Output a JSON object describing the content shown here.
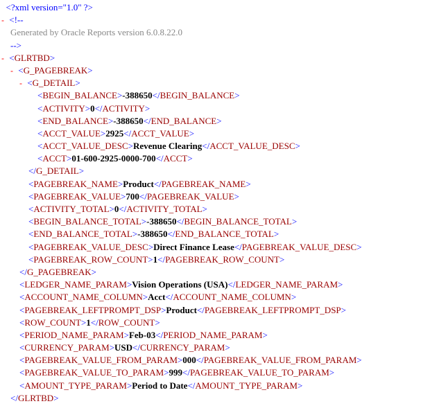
{
  "xml_decl": "<?xml version=\"1.0\" ?>",
  "comment": "Generated by Oracle Reports version 6.0.8.22.0",
  "toggles": {
    "minus": "-"
  },
  "tags": {
    "GLRTBD": "GLRTBD",
    "G_PAGEBREAK": "G_PAGEBREAK",
    "G_DETAIL": "G_DETAIL",
    "BEGIN_BALANCE": "BEGIN_BALANCE",
    "ACTIVITY": "ACTIVITY",
    "END_BALANCE": "END_BALANCE",
    "ACCT_VALUE": "ACCT_VALUE",
    "ACCT_VALUE_DESC": "ACCT_VALUE_DESC",
    "ACCT": "ACCT",
    "PAGEBREAK_NAME": "PAGEBREAK_NAME",
    "PAGEBREAK_VALUE": "PAGEBREAK_VALUE",
    "ACTIVITY_TOTAL": "ACTIVITY_TOTAL",
    "BEGIN_BALANCE_TOTAL": "BEGIN_BALANCE_TOTAL",
    "END_BALANCE_TOTAL": "END_BALANCE_TOTAL",
    "PAGEBREAK_VALUE_DESC": "PAGEBREAK_VALUE_DESC",
    "PAGEBREAK_ROW_COUNT": "PAGEBREAK_ROW_COUNT",
    "LEDGER_NAME_PARAM": "LEDGER_NAME_PARAM",
    "ACCOUNT_NAME_COLUMN": "ACCOUNT_NAME_COLUMN",
    "PAGEBREAK_LEFTPROMPT_DSP": "PAGEBREAK_LEFTPROMPT_DSP",
    "ROW_COUNT": "ROW_COUNT",
    "PERIOD_NAME_PARAM": "PERIOD_NAME_PARAM",
    "CURRENCY_PARAM": "CURRENCY_PARAM",
    "PAGEBREAK_VALUE_FROM_PARAM": "PAGEBREAK_VALUE_FROM_PARAM",
    "PAGEBREAK_VALUE_TO_PARAM": "PAGEBREAK_VALUE_TO_PARAM",
    "AMOUNT_TYPE_PARAM": "AMOUNT_TYPE_PARAM"
  },
  "values": {
    "begin_balance": "-388650",
    "activity": "0",
    "end_balance": "-388650",
    "acct_value": "2925",
    "acct_value_desc": "Revenue Clearing",
    "acct": "01-600-2925-0000-700",
    "pagebreak_name": "Product",
    "pagebreak_value": "700",
    "activity_total": "0",
    "begin_balance_total": "-388650",
    "end_balance_total": "-388650",
    "pagebreak_value_desc": "Direct Finance Lease",
    "pagebreak_row_count": "1",
    "ledger_name_param": "Vision Operations (USA)",
    "account_name_column": "Acct",
    "pagebreak_leftprompt_dsp": "Product",
    "row_count": "1",
    "period_name_param": "Feb-03",
    "currency_param": "USD",
    "pagebreak_value_from_param": "000",
    "pagebreak_value_to_param": "999",
    "amount_type_param": "Period to Date"
  }
}
